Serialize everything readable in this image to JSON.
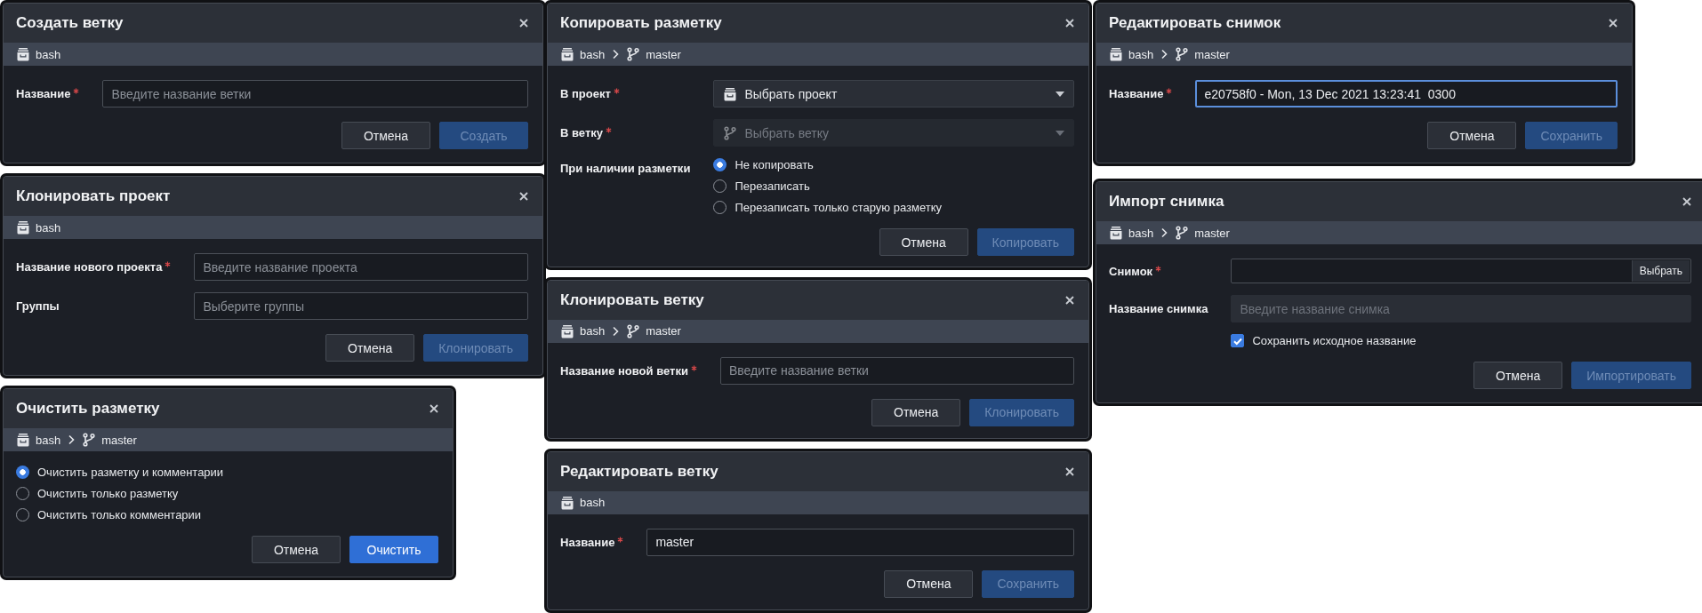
{
  "columns": [
    {
      "dialogs": [
        {
          "title": "Создать ветку",
          "breadcrumb": [
            {
              "kind": "project",
              "label": "bash"
            }
          ],
          "fields": [
            {
              "kind": "text",
              "label": "Название",
              "required": true,
              "placeholder": "Введите название ветки",
              "focused": false,
              "disabled": false
            }
          ],
          "buttons": [
            {
              "label": "Отмена",
              "kind": "secondary",
              "disabled": false
            },
            {
              "label": "Создать",
              "kind": "primary",
              "disabled": true
            }
          ]
        },
        {
          "title": "Клонировать проект",
          "breadcrumb": [
            {
              "kind": "project",
              "label": "bash"
            }
          ],
          "fields": [
            {
              "kind": "text",
              "label": "Название нового проекта",
              "required": true,
              "placeholder": "Введите название проекта",
              "focused": false,
              "disabled": false
            },
            {
              "kind": "text",
              "label": "Группы",
              "required": false,
              "placeholder": "Выберите группы",
              "focused": false,
              "disabled": false
            }
          ],
          "buttons": [
            {
              "label": "Отмена",
              "kind": "secondary",
              "disabled": false
            },
            {
              "label": "Клонировать",
              "kind": "primary",
              "disabled": true
            }
          ]
        },
        {
          "title": "Очистить разметку",
          "breadcrumb": [
            {
              "kind": "project",
              "label": "bash"
            },
            {
              "kind": "branch",
              "label": "master"
            }
          ],
          "fields": [
            {
              "kind": "radio",
              "options": [
                {
                  "label": "Очистить разметку и комментарии",
                  "selected": true
                },
                {
                  "label": "Очистить только разметку",
                  "selected": false
                },
                {
                  "label": "Очистить только комментарии",
                  "selected": false
                }
              ]
            }
          ],
          "buttons": [
            {
              "label": "Отмена",
              "kind": "secondary",
              "disabled": false
            },
            {
              "label": "Очистить",
              "kind": "primary",
              "disabled": false
            }
          ]
        }
      ]
    },
    {
      "dialogs": [
        {
          "title": "Копировать разметку",
          "breadcrumb": [
            {
              "kind": "project",
              "label": "bash"
            },
            {
              "kind": "branch",
              "label": "master"
            }
          ],
          "fields": [
            {
              "kind": "select",
              "label": "В проект",
              "required": true,
              "placeholder": "Выбрать проект",
              "focused": false,
              "disabled": false
            },
            {
              "kind": "select",
              "label": "В ветку",
              "required": true,
              "placeholder": "Выбрать ветку",
              "focused": false,
              "disabled": true
            },
            {
              "kind": "radio",
              "label": "При наличии разметки",
              "required": false,
              "options": [
                {
                  "label": "Не копировать",
                  "selected": true
                },
                {
                  "label": "Перезаписать",
                  "selected": false
                },
                {
                  "label": "Перезаписать только старую разметку",
                  "selected": false
                }
              ]
            }
          ],
          "buttons": [
            {
              "label": "Отмена",
              "kind": "secondary",
              "disabled": false
            },
            {
              "label": "Копировать",
              "kind": "primary",
              "disabled": true
            }
          ]
        },
        {
          "title": "Клонировать ветку",
          "breadcrumb": [
            {
              "kind": "project",
              "label": "bash"
            },
            {
              "kind": "branch",
              "label": "master"
            }
          ],
          "fields": [
            {
              "kind": "text",
              "label": "Название новой ветки",
              "required": true,
              "placeholder": "Введите название ветки",
              "focused": false,
              "disabled": false
            }
          ],
          "buttons": [
            {
              "label": "Отмена",
              "kind": "secondary",
              "disabled": false
            },
            {
              "label": "Клонировать",
              "kind": "primary",
              "disabled": true
            }
          ]
        },
        {
          "title": "Редактировать ветку",
          "breadcrumb": [
            {
              "kind": "project",
              "label": "bash"
            }
          ],
          "fields": [
            {
              "kind": "text",
              "label": "Название",
              "required": true,
              "value": "master",
              "focused": false,
              "disabled": false
            }
          ],
          "buttons": [
            {
              "label": "Отмена",
              "kind": "secondary",
              "disabled": false
            },
            {
              "label": "Сохранить",
              "kind": "primary",
              "disabled": true
            }
          ]
        }
      ]
    },
    {
      "dialogs": [
        {
          "title": "Редактировать снимок",
          "breadcrumb": [
            {
              "kind": "project",
              "label": "bash"
            },
            {
              "kind": "branch",
              "label": "master"
            }
          ],
          "fields": [
            {
              "kind": "text",
              "label": "Название",
              "required": true,
              "value": "e20758f0 - Mon, 13 Dec 2021 13:23:41  0300",
              "focused": true,
              "disabled": false
            }
          ],
          "buttons": [
            {
              "label": "Отмена",
              "kind": "secondary",
              "disabled": false
            },
            {
              "label": "Сохранить",
              "kind": "primary",
              "disabled": true
            }
          ]
        },
        {
          "title": "Импорт снимка",
          "breadcrumb": [
            {
              "kind": "project",
              "label": "bash"
            },
            {
              "kind": "branch",
              "label": "master"
            }
          ],
          "fields": [
            {
              "kind": "file",
              "label": "Снимок",
              "required": true,
              "button": "Выбрать",
              "focused": false,
              "disabled": false
            },
            {
              "kind": "text",
              "label": "Название снимка",
              "required": false,
              "placeholder": "Введите название снимка",
              "focused": false,
              "disabled": true
            },
            {
              "kind": "checkbox",
              "label": "Сохранить исходное название",
              "checked": true
            }
          ],
          "buttons": [
            {
              "label": "Отмена",
              "kind": "secondary",
              "disabled": false
            },
            {
              "label": "Импортировать",
              "kind": "primary",
              "disabled": true
            }
          ]
        }
      ]
    }
  ]
}
